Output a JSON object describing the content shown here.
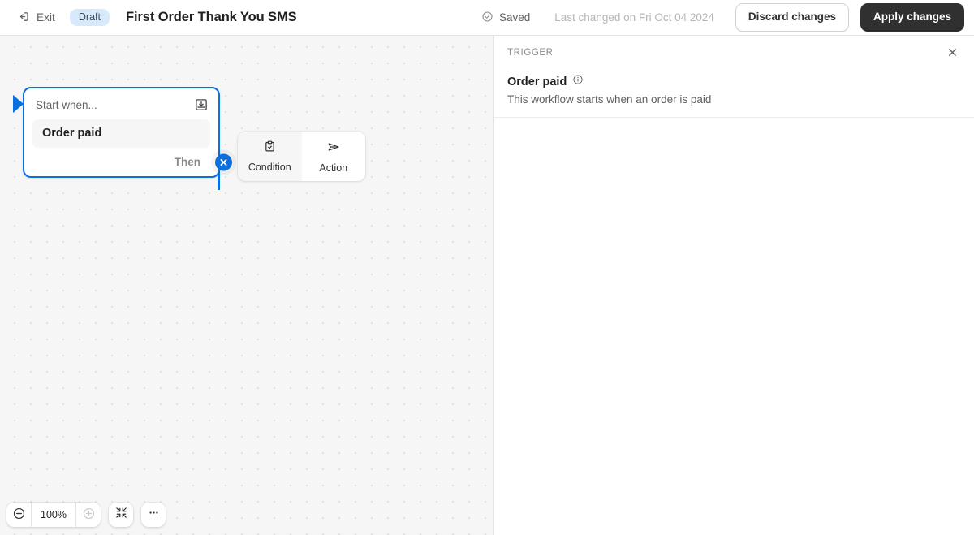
{
  "topbar": {
    "exit_label": "Exit",
    "exit_icon": "exit-arrow-icon",
    "status_badge": "Draft",
    "workflow_title": "First Order Thank You SMS",
    "saved_label": "Saved",
    "saved_icon": "check-circle-icon",
    "last_changed": "Last changed on Fri Oct 04 2024",
    "discard_label": "Discard changes",
    "apply_label": "Apply changes"
  },
  "canvas": {
    "trigger_card": {
      "head_label": "Start when...",
      "head_icon": "inbox-download-icon",
      "field_value": "Order paid",
      "then_label": "Then",
      "remove_icon": "close-circle-icon"
    },
    "add_popover": {
      "options": [
        {
          "label": "Condition",
          "icon": "clipboard-check-icon",
          "active": false
        },
        {
          "label": "Action",
          "icon": "send-paper-plane-icon",
          "active": true
        }
      ]
    },
    "zoom": {
      "out_icon": "minus-circle-icon",
      "level": "100%",
      "in_icon": "plus-circle-icon",
      "fit_icon": "fit-to-screen-icon",
      "more_icon": "ellipsis-icon"
    }
  },
  "side_panel": {
    "kicker": "TRIGGER",
    "close_icon": "close-icon",
    "title": "Order paid",
    "info_icon": "info-circle-icon",
    "description": "This workflow starts when an order is paid"
  },
  "colors": {
    "accent_blue": "#0c6fde",
    "badge_bg": "#d8e9fb",
    "canvas_bg": "#f6f6f7",
    "primary_btn_bg": "#303030",
    "text_primary": "#1f1f1f",
    "text_subdued": "#616161"
  }
}
